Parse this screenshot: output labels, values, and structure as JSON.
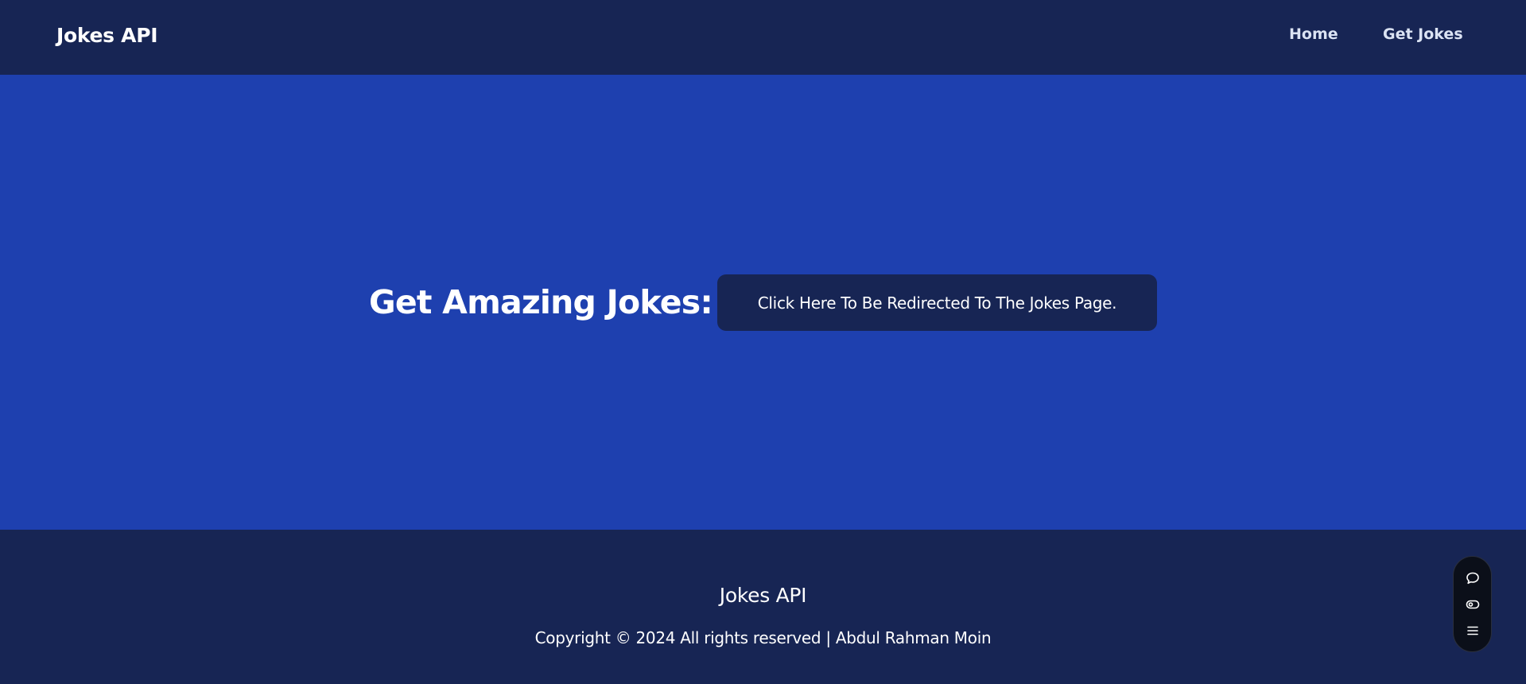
{
  "header": {
    "brand": "Jokes API",
    "nav": [
      {
        "label": "Home"
      },
      {
        "label": "Get Jokes"
      }
    ]
  },
  "hero": {
    "heading": "Get Amazing Jokes:",
    "button_label": "Click Here To Be Redirected To The Jokes Page."
  },
  "footer": {
    "title": "Jokes API",
    "copyright": "Copyright © 2024 All rights reserved | Abdul Rahman Moin"
  },
  "floating_toolbar": {
    "icons": [
      "chat-bubble-icon",
      "eye-toggle-icon",
      "menu-icon"
    ]
  },
  "colors": {
    "header_bg": "#172554",
    "hero_bg": "#1e40af",
    "button_bg": "#172554",
    "footer_bg": "#172554",
    "text": "#ffffff"
  }
}
